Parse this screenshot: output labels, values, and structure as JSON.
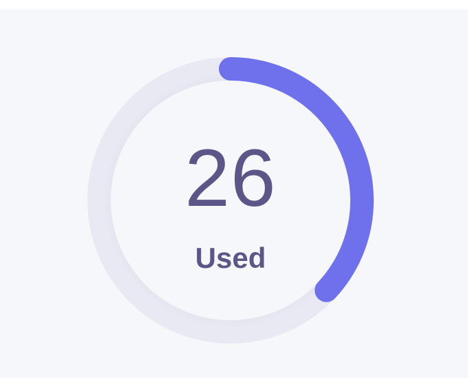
{
  "gauge": {
    "value": "26",
    "label": "Used",
    "progress_fraction": 0.37,
    "colors": {
      "track": "#e8e9f2",
      "progress": "#6f70ec",
      "text": "#5b5687",
      "background": "#f6f7fb"
    }
  }
}
